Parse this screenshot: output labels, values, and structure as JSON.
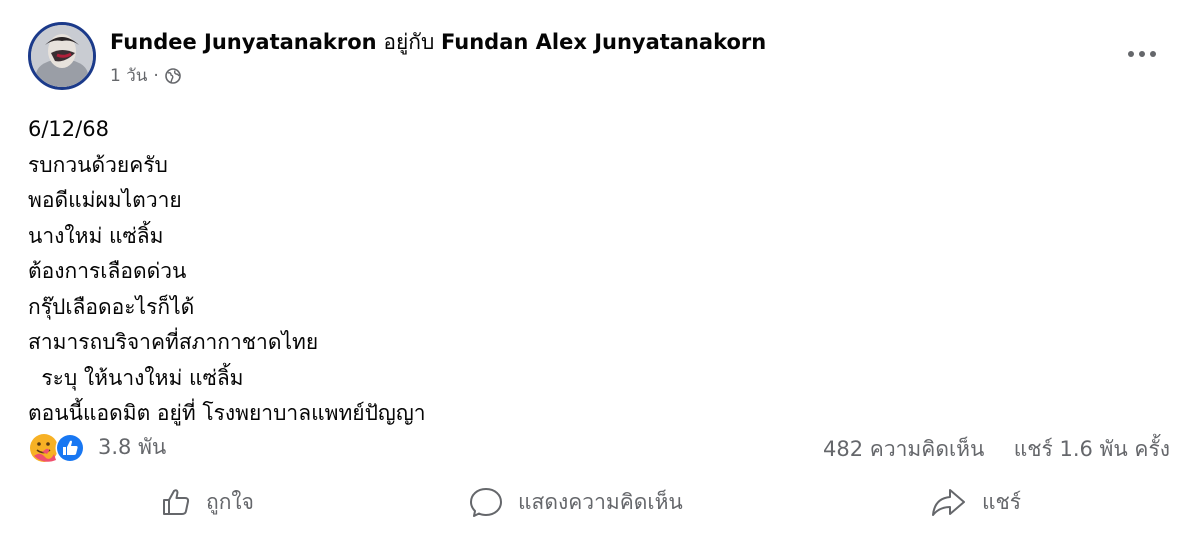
{
  "header": {
    "author": "Fundee Junyatanakron",
    "with_text": "อยู่กับ",
    "tagged": "Fundan Alex Junyatanakorn",
    "time": "1 วัน",
    "separator": "·",
    "privacy_icon": "globe-icon",
    "more_icon": "more-icon"
  },
  "post": {
    "lines": [
      "6/12/68",
      "รบกวนด้วยครับ",
      "พอดีแม่ผมไตวาย",
      "นางใหม่ แซ่ลิ้ม",
      "ต้องการเลือดด่วน",
      "กรุ๊ปเลือดอะไรก็ได้",
      "สามารถบริจาคที่สภากาชาดไทย",
      "  ระบุ ให้นางใหม่ แซ่ลิ้ม",
      "ตอนนี้แอดมิต อยู่ที่ โรงพยาบาลแพทย์ปัญญา"
    ]
  },
  "reactions": {
    "icons": [
      "care-reaction-icon",
      "like-reaction-icon"
    ],
    "count": "3.8 พัน"
  },
  "stats": {
    "comments": "482 ความคิดเห็น",
    "shares": "แชร์ 1.6 พัน ครั้ง"
  },
  "actions": {
    "like": "ถูกใจ",
    "comment": "แสดงความคิดเห็น",
    "share": "แชร์"
  },
  "colors": {
    "secondary_text": "#65676b",
    "like_blue": "#1877f2",
    "care_yellow": "#f7b125",
    "avatar_ring": "#1b3a8a"
  }
}
